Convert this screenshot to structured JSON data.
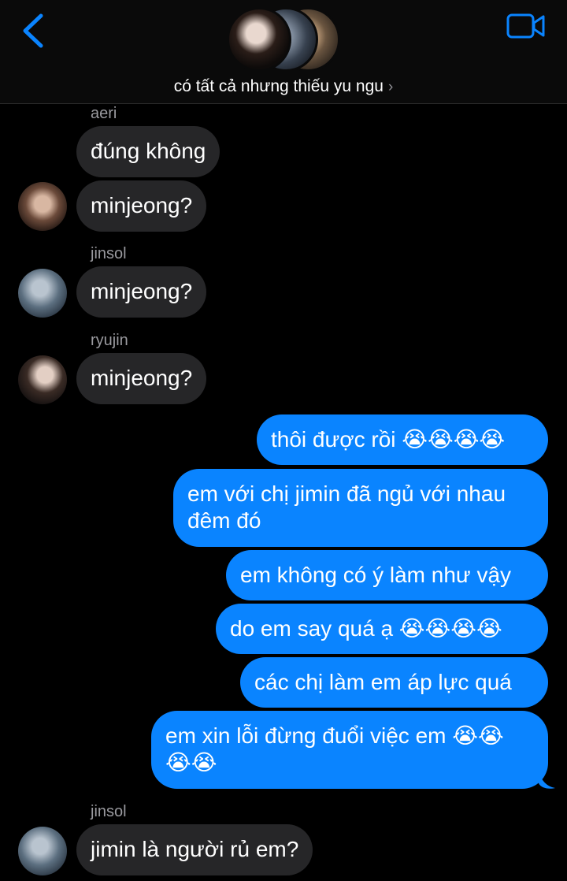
{
  "header": {
    "group_name": "có tất cả nhưng thiếu yu ngu",
    "chevron": "›",
    "back_icon": "chevron-left-icon",
    "video_icon": "video-camera-icon",
    "accent_color": "#0a84ff"
  },
  "messages": [
    {
      "sender": "aeri",
      "text": "đúng không"
    },
    {
      "text": "minjeong?"
    },
    {
      "sender": "jinsol",
      "text": "minjeong?"
    },
    {
      "sender": "ryujin",
      "text": "minjeong?"
    },
    {
      "text": "thôi được rồi 😭😭😭😭"
    },
    {
      "line1": "em với chị jimin đã ngủ với nhau",
      "line2": "đêm đó"
    },
    {
      "text": "em không có ý làm như vậy"
    },
    {
      "text": "do em say quá ạ 😭😭😭😭"
    },
    {
      "text": "các chị làm em áp lực quá"
    },
    {
      "line1": "em xin lỗi đừng đuổi việc em 😭😭",
      "line2": "😭😭"
    },
    {
      "sender": "jinsol",
      "text": "jimin là người rủ em?"
    }
  ],
  "colors": {
    "incoming_bubble": "#262628",
    "outgoing_bubble": "#0a84ff",
    "background": "#000000"
  }
}
